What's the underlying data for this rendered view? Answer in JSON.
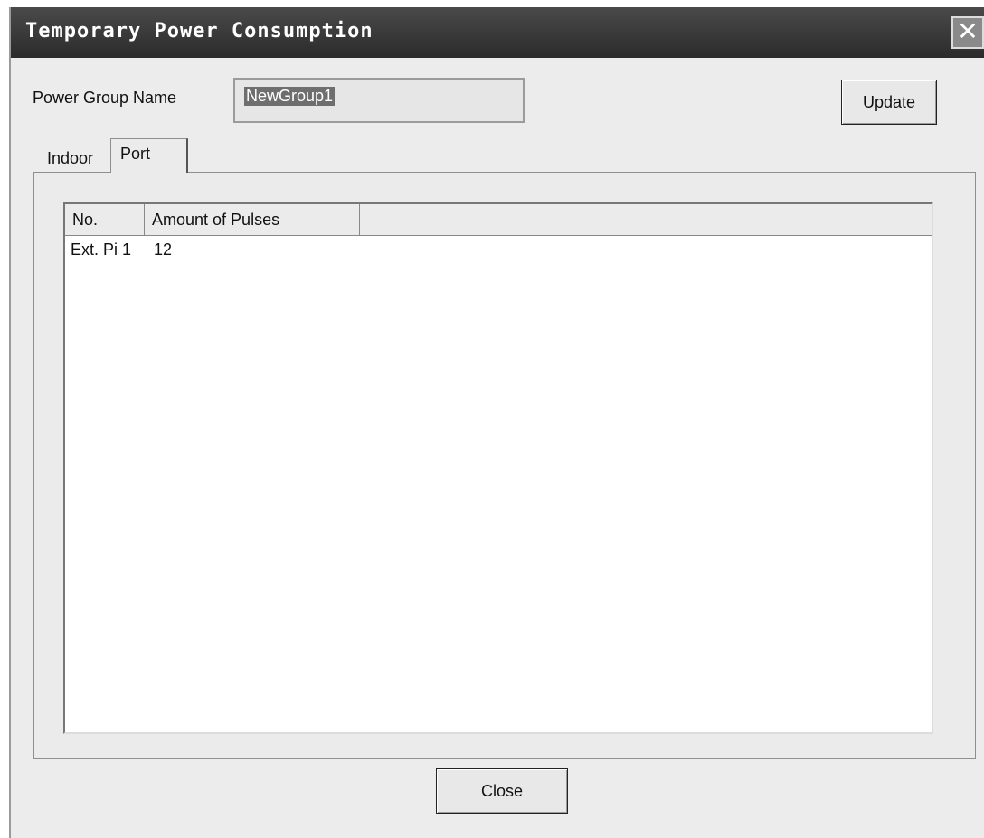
{
  "window": {
    "title": "Temporary Power Consumption",
    "close_glyph": "✕"
  },
  "form": {
    "group_label": "Power Group Name",
    "group_value": "NewGroup1",
    "update_label": "Update"
  },
  "tabs": [
    {
      "label": "Indoor",
      "active": false
    },
    {
      "label": "Port",
      "active": true
    }
  ],
  "table": {
    "columns": [
      "No.",
      "Amount of Pulses"
    ],
    "rows": [
      [
        "Ext. Pi 1",
        "12"
      ]
    ]
  },
  "footer": {
    "close_label": "Close"
  },
  "icons": {
    "close": "close-icon"
  }
}
